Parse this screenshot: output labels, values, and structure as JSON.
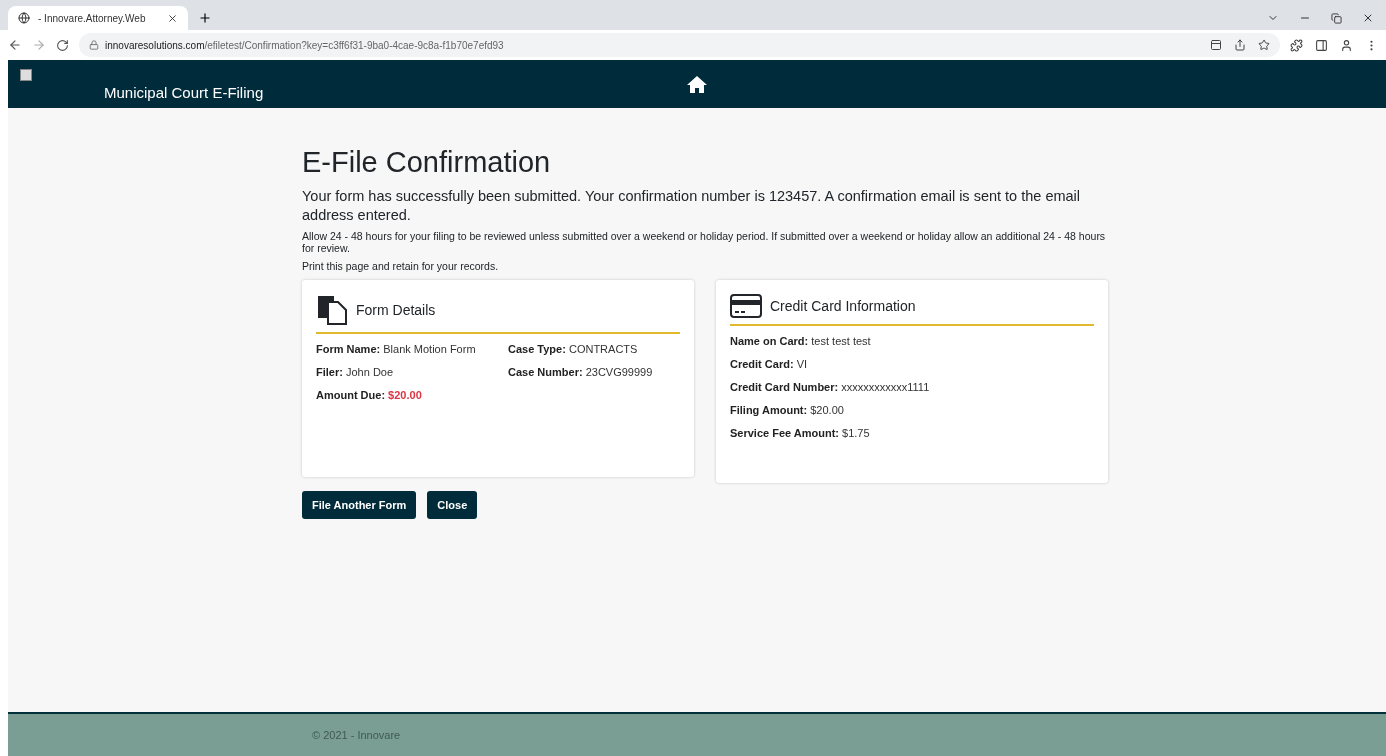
{
  "browser": {
    "tab": {
      "title": "- Innovare.Attorney.Web"
    },
    "address": {
      "domain": "innovaresolutions.com",
      "path": "/efiletest/Confirmation?key=c3ff6f31-9ba0-4cae-9c8a-f1b70e7efd93"
    }
  },
  "navbar": {
    "brand": "Municipal Court E-Filing"
  },
  "page": {
    "title": "E-File Confirmation",
    "lead": "Your form has successfully been submitted. Your confirmation number is 123457. A confirmation email is sent to the email address entered.",
    "notes": [
      "Allow 24 - 48 hours for your filing to be reviewed unless submitted over a weekend or holiday period. If submitted over a weekend or holiday allow an additional 24 - 48 hours for review.",
      "Print this page and retain for your records."
    ]
  },
  "cards": [
    {
      "kind": "form",
      "title": "Form Details",
      "columns": [
        [
          {
            "label": "Form Name:",
            "value": "Blank Motion Form",
            "alert": false
          },
          {
            "label": "Filer:",
            "value": "John Doe",
            "alert": false
          },
          {
            "label": "Amount Due:",
            "value": "$20.00",
            "alert": true
          }
        ],
        [
          {
            "label": "Case Type:",
            "value": "CONTRACTS",
            "alert": false
          },
          {
            "label": "Case Number:",
            "value": "23CVG99999",
            "alert": false
          }
        ]
      ]
    },
    {
      "kind": "card",
      "title": "Credit Card Information",
      "columns": [
        [
          {
            "label": "Name on Card:",
            "value": "test test test",
            "alert": false
          },
          {
            "label": "Credit Card:",
            "value": "VI",
            "alert": false
          },
          {
            "label": "Credit Card Number:",
            "value": "xxxxxxxxxxxx1111",
            "alert": false
          },
          {
            "label": "Filing Amount:",
            "value": "$20.00",
            "alert": false
          },
          {
            "label": "Service Fee Amount:",
            "value": "$1.75",
            "alert": false
          }
        ]
      ]
    }
  ],
  "buttons": [
    "File Another Form",
    "Close"
  ],
  "footer": "© 2021 - Innovare"
}
